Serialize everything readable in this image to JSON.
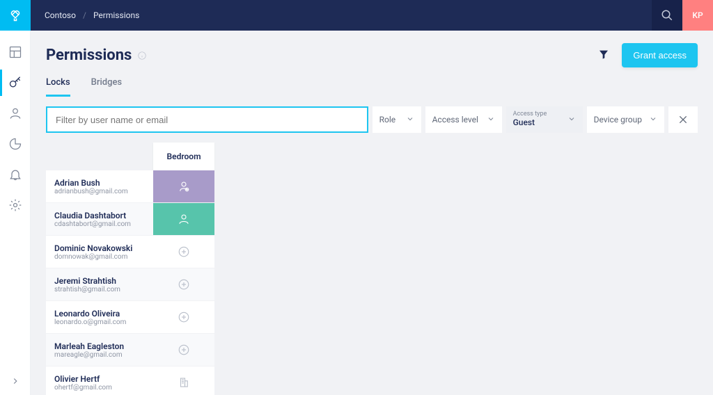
{
  "topbar": {
    "breadcrumb_root": "Contoso",
    "breadcrumb_current": "Permissions",
    "user_initials": "KP"
  },
  "page": {
    "title": "Permissions",
    "grant_button": "Grant access"
  },
  "tabs": {
    "locks": "Locks",
    "bridges": "Bridges"
  },
  "filters": {
    "search_placeholder": "Filter by user name or email",
    "role_label": "Role",
    "access_level_label": "Access level",
    "access_type_title": "Access type",
    "access_type_value": "Guest",
    "device_group_label": "Device group"
  },
  "device_column_header": "Bedroom",
  "users": [
    {
      "name": "Adrian Bush",
      "email": "adrianbush@gmail.com",
      "perm": "admin"
    },
    {
      "name": "Claudia Dashtabort",
      "email": "cdashtabort@gmail.com",
      "perm": "user"
    },
    {
      "name": "Dominic Novakowski",
      "email": "domnowak@gmail.com",
      "perm": "none"
    },
    {
      "name": "Jeremi Strahtish",
      "email": "strahtish@gmail.com",
      "perm": "none"
    },
    {
      "name": "Leonardo Oliveira",
      "email": "leonardo.o@gmail.com",
      "perm": "none"
    },
    {
      "name": "Marleah Eagleston",
      "email": "mareagle@gmail.com",
      "perm": "none"
    },
    {
      "name": "Olivier Hertf",
      "email": "ohertf@gmail.com",
      "perm": "building"
    }
  ]
}
